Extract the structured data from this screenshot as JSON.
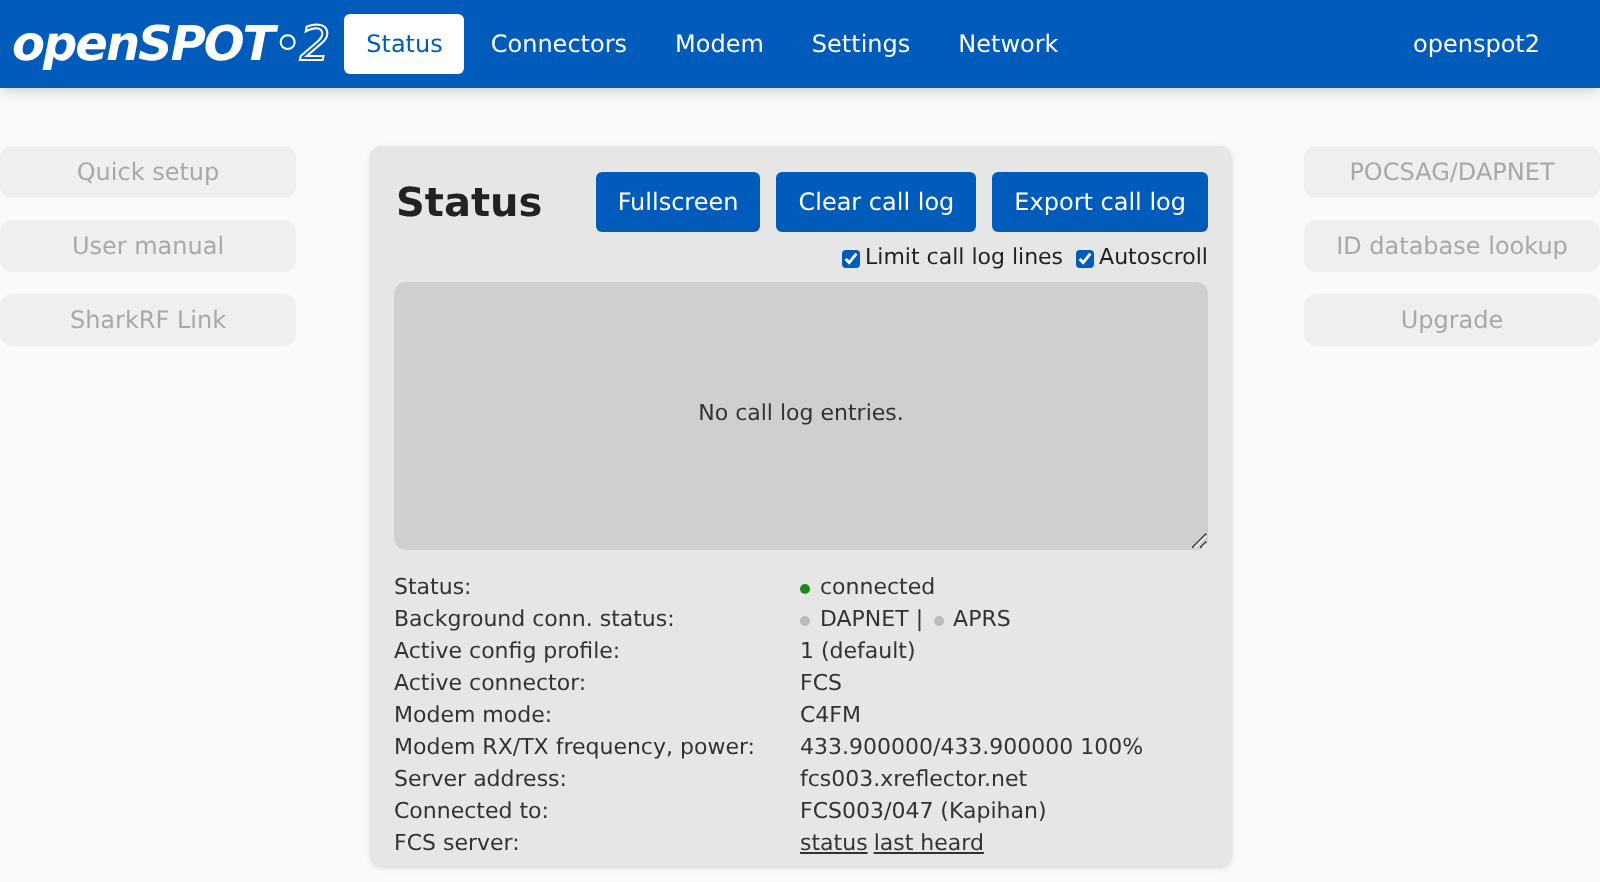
{
  "navbar": {
    "logo": {
      "name": "openSPOT",
      "suffix": "•2"
    },
    "tabs": [
      {
        "label": "Status",
        "selected": true
      },
      {
        "label": "Connectors",
        "selected": false
      },
      {
        "label": "Modem",
        "selected": false
      },
      {
        "label": "Settings",
        "selected": false
      },
      {
        "label": "Network",
        "selected": false
      }
    ],
    "hostname": "openspot2"
  },
  "left_links": [
    "Quick setup",
    "User manual",
    "SharkRF Link"
  ],
  "right_links": [
    "POCSAG/DAPNET",
    "ID database lookup",
    "Upgrade"
  ],
  "panel": {
    "title": "Status",
    "buttons": [
      "Fullscreen",
      "Clear call log",
      "Export call log"
    ],
    "options": [
      {
        "label": "Limit call log lines",
        "checked": true
      },
      {
        "label": "Autoscroll",
        "checked": true
      }
    ],
    "call_log": {
      "placeholder": "No call log entries."
    },
    "rows": [
      {
        "label": "Status:",
        "value": [
          {
            "kind": "dot",
            "color": "#1a8a1a"
          },
          {
            "kind": "text",
            "text": "connected"
          }
        ]
      },
      {
        "label": "Background conn. status:",
        "value": [
          {
            "kind": "dot",
            "color": "#bbbbbb"
          },
          {
            "kind": "text",
            "text": "DAPNET |"
          },
          {
            "kind": "dot",
            "color": "#bbbbbb"
          },
          {
            "kind": "text",
            "text": "APRS"
          }
        ]
      },
      {
        "label": "Active config profile:",
        "value": [
          {
            "kind": "text",
            "text": "1 (default)"
          }
        ]
      },
      {
        "label": "Active connector:",
        "value": [
          {
            "kind": "text",
            "text": "FCS"
          }
        ]
      },
      {
        "label": "Modem mode:",
        "value": [
          {
            "kind": "text",
            "text": "C4FM"
          }
        ]
      },
      {
        "label": "Modem RX/TX frequency, power:",
        "value": [
          {
            "kind": "text",
            "text": "433.900000/433.900000 100%"
          }
        ]
      },
      {
        "label": "Server address:",
        "value": [
          {
            "kind": "text",
            "text": "fcs003.xreflector.net"
          }
        ]
      },
      {
        "label": "Connected to:",
        "value": [
          {
            "kind": "text",
            "text": "FCS003/047 (Kapihan)"
          }
        ]
      },
      {
        "label": "FCS server:",
        "value": [
          {
            "kind": "link",
            "text": "status"
          },
          {
            "kind": "link",
            "text": "last heard"
          }
        ]
      }
    ]
  }
}
